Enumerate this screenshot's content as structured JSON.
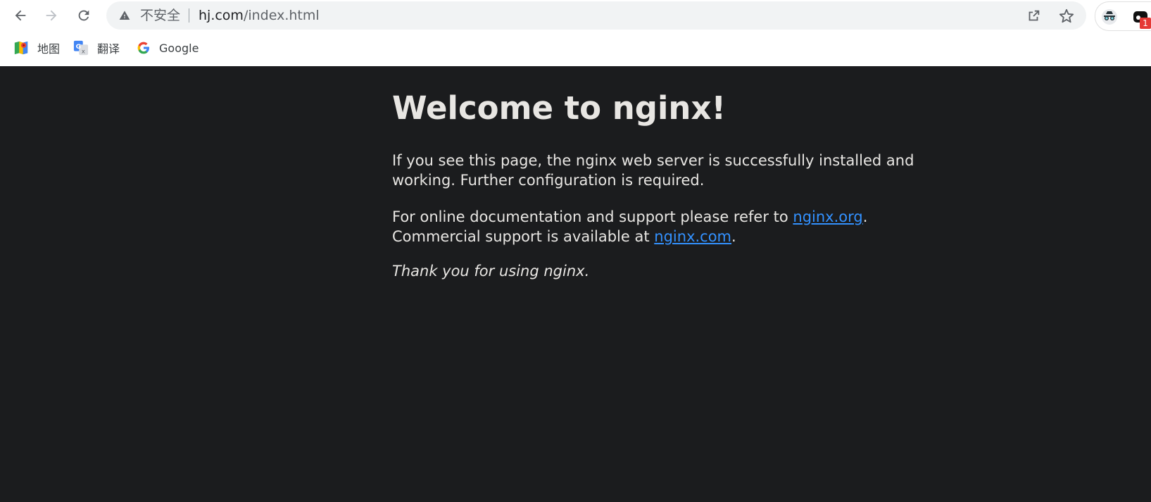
{
  "browser": {
    "security_label": "不安全",
    "url_host": "hj.com",
    "url_path": "/index.html",
    "extension_badge": "1",
    "bookmarks": [
      {
        "label": "地图",
        "icon": "maps-icon"
      },
      {
        "label": "翻译",
        "icon": "translate-icon"
      },
      {
        "label": "Google",
        "icon": "google-icon"
      }
    ]
  },
  "page": {
    "heading": "Welcome to nginx!",
    "p1": "If you see this page, the nginx web server is successfully installed and working. Further configuration is required.",
    "p2_a": "For online documentation and support please refer to ",
    "p2_link1": "nginx.org",
    "p2_b": ".",
    "p2_c": "Commercial support is available at ",
    "p2_link2": "nginx.com",
    "p2_d": ".",
    "p3": "Thank you for using nginx."
  },
  "colors": {
    "page_background": "#1b1c1e",
    "text": "#e8e6e3",
    "link": "#3391ff",
    "omnibox": "#f1f3f4"
  }
}
